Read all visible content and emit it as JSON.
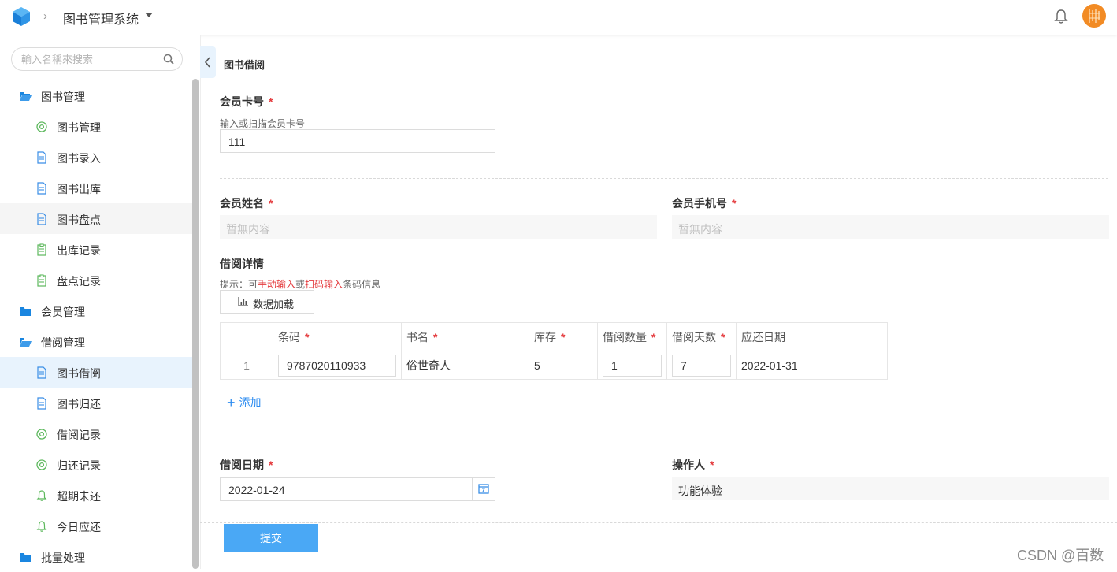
{
  "header": {
    "app_title": "图书管理系统",
    "breadcrumb_sep": "›"
  },
  "sidebar": {
    "search_placeholder": "輸入名稱來搜索",
    "items": [
      {
        "label": "图书管理",
        "icon": "folder-open-icon",
        "level": "group"
      },
      {
        "label": "图书管理",
        "icon": "circle-icon",
        "level": "sub"
      },
      {
        "label": "图书录入",
        "icon": "document-icon",
        "level": "sub"
      },
      {
        "label": "图书出库",
        "icon": "document-icon",
        "level": "sub"
      },
      {
        "label": "图书盘点",
        "icon": "document-icon",
        "level": "sub",
        "state": "hover"
      },
      {
        "label": "出库记录",
        "icon": "clipboard-icon",
        "level": "sub"
      },
      {
        "label": "盘点记录",
        "icon": "clipboard-icon",
        "level": "sub"
      },
      {
        "label": "会员管理",
        "icon": "folder-icon",
        "level": "group"
      },
      {
        "label": "借阅管理",
        "icon": "folder-open-icon",
        "level": "group"
      },
      {
        "label": "图书借阅",
        "icon": "document-icon",
        "level": "sub",
        "state": "active"
      },
      {
        "label": "图书归还",
        "icon": "document-icon",
        "level": "sub"
      },
      {
        "label": "借阅记录",
        "icon": "circle-icon",
        "level": "sub"
      },
      {
        "label": "归还记录",
        "icon": "circle-icon",
        "level": "sub"
      },
      {
        "label": "超期未还",
        "icon": "bell-icon",
        "level": "sub"
      },
      {
        "label": "今日应还",
        "icon": "bell-icon",
        "level": "sub"
      },
      {
        "label": "批量处理",
        "icon": "folder-icon",
        "level": "group"
      }
    ]
  },
  "main": {
    "page_title": "图书借阅",
    "member_card": {
      "label": "会员卡号",
      "required_mark": "*",
      "hint": "输入或扫描会员卡号",
      "value": "111"
    },
    "member_name": {
      "label": "会员姓名",
      "required_mark": "*",
      "value": "暂無内容"
    },
    "member_phone": {
      "label": "会员手机号",
      "required_mark": "*",
      "value": "暂無内容"
    },
    "borrow_details": {
      "label": "借阅详情",
      "hint_prefix": "提示：可",
      "hint_manual": "手动输入",
      "hint_or": "或",
      "hint_scan": "扫码输入",
      "hint_suffix": "条码信息",
      "load_button": "数据加载",
      "columns": [
        {
          "label": "",
          "required": false
        },
        {
          "label": "条码",
          "required": true
        },
        {
          "label": "书名",
          "required": true
        },
        {
          "label": "库存",
          "required": true
        },
        {
          "label": "借阅数量",
          "required": true
        },
        {
          "label": "借阅天数",
          "required": true
        },
        {
          "label": "应还日期",
          "required": false
        }
      ],
      "rows": [
        {
          "index": "1",
          "barcode": "9787020110933",
          "title": "俗世奇人",
          "stock": "5",
          "quantity": "1",
          "days": "7",
          "due_date": "2022-01-31"
        }
      ],
      "add_label": "添加"
    },
    "borrow_date": {
      "label": "借阅日期",
      "required_mark": "*",
      "value": "2022-01-24"
    },
    "operator": {
      "label": "操作人",
      "required_mark": "*",
      "value": "功能体验"
    },
    "submit_label": "提交"
  },
  "watermark": "CSDN @百数",
  "colors": {
    "accent": "#2d8cf0",
    "required": "#e4393c",
    "submit_bg": "#4aa8f5",
    "active_bg": "#e8f3fd"
  }
}
